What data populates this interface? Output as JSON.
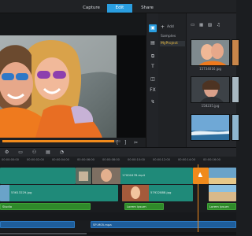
{
  "header": {
    "tabs": [
      {
        "label": "Capture",
        "active": false
      },
      {
        "label": "Edit",
        "active": true
      },
      {
        "label": "Share",
        "active": false
      }
    ]
  },
  "player": {
    "timecode": "00:00:00:00",
    "end_timecode": "00:00:15:00"
  },
  "library": {
    "add_label": "Add",
    "tree": [
      {
        "label": "Samples",
        "selected": false
      },
      {
        "label": "MyProject",
        "selected": true
      }
    ],
    "thumbnails": [
      {
        "label": "15734016.jpg"
      },
      {
        "label": "158235.jpg"
      },
      {
        "label": "",
        "icon": "video"
      },
      {
        "label": "",
        "icon": "photo"
      }
    ],
    "browse_label": "Browse"
  },
  "timeline": {
    "ruler": [
      "00:00:00:00",
      "00:00:02:00",
      "00:00:04:00",
      "00:00:06:00",
      "00:00:08:00",
      "00:00:10:00",
      "00:00:12:00",
      "00:00:14:00",
      "00:00:16:00",
      "00:00:18:00"
    ],
    "video_clips": [
      {
        "label": "17000478.mp4"
      },
      {
        "label": ""
      }
    ],
    "overlay_clips": [
      {
        "label": "53613229.jpg"
      },
      {
        "label": "57922888.jpg"
      }
    ],
    "title_clips": [
      {
        "label": "Studio"
      },
      {
        "label": "Lorem ipsum"
      },
      {
        "label": "Lorem ipsum"
      }
    ],
    "music_clip": {
      "label": "SP-M05.mpa"
    }
  },
  "colors": {
    "accent": "#2a9ee0",
    "video_track": "#1f8a79",
    "title_track": "#2f8a2a",
    "music_track": "#1e5d9a",
    "playhead": "#f08a1c"
  }
}
